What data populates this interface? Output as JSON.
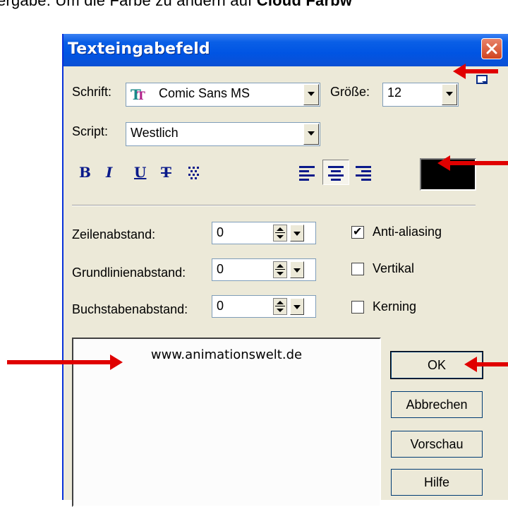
{
  "caption": {
    "prefix": "ergabe.  Um die Farbe zu ändern auf ",
    "bold": "Cloud Farbw"
  },
  "dialog": {
    "title": "Texteingabefeld",
    "font": {
      "label": "Schrift:",
      "value": "Comic Sans MS",
      "icon": "truetype-font-icon"
    },
    "size": {
      "label": "Größe:",
      "value": "12"
    },
    "script": {
      "label": "Script:",
      "value": "Westlich"
    },
    "format_buttons": [
      "B",
      "I",
      "U",
      "T"
    ],
    "text_color": "#000000",
    "spacing": [
      {
        "label": "Zeilenabstand:",
        "value": "0"
      },
      {
        "label": "Grundlinienabstand:",
        "value": "0"
      },
      {
        "label": "Buchstabenabstand:",
        "value": "0"
      }
    ],
    "options": [
      {
        "label": "Anti-aliasing",
        "checked": true
      },
      {
        "label": "Vertikal",
        "checked": false
      },
      {
        "label": "Kerning",
        "checked": false
      }
    ],
    "text_content": "www.animationswelt.de",
    "buttons": {
      "ok": "OK",
      "cancel": "Abbrechen",
      "preview": "Vorschau",
      "help": "Hilfe"
    }
  },
  "colors": {
    "titlebar": "#0054e3",
    "dialog_bg": "#ece9d8",
    "arrow": "#e00000"
  }
}
